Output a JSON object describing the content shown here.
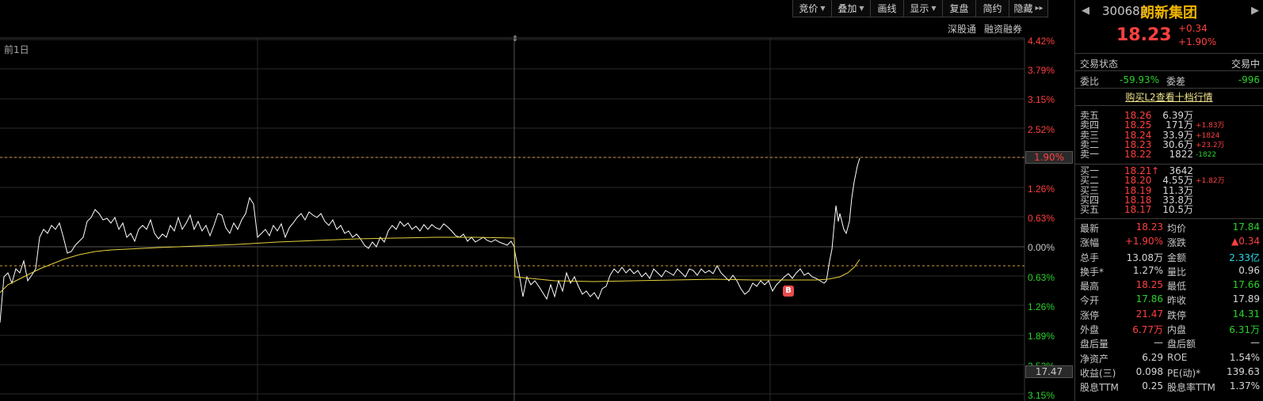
{
  "toolbar": {
    "bid": "竞价",
    "overlay": "叠加",
    "draw": "画线",
    "display": "显示",
    "replay": "复盘",
    "simple": "简约",
    "hide": "隐藏",
    "more": "▸▸"
  },
  "sublinks": {
    "sgt": "深股通",
    "margin": "融资融券"
  },
  "chart": {
    "front_day": "前1日",
    "y_labels": [
      "4.42%",
      "3.79%",
      "3.15%",
      "2.52%",
      "1.90%",
      "1.26%",
      "0.63%",
      "0.00%",
      "0.63%",
      "1.26%",
      "1.89%",
      "2.52%",
      "3.15%"
    ],
    "price_tag": "1.90%",
    "low_tag": "17.47",
    "b_marker": "B",
    "colors": {
      "price_line": "#ffffff",
      "avg_line": "#e8d23c",
      "grid": "#2a2a2a",
      "dash": "#d89a3c"
    }
  },
  "panel": {
    "code": "300682",
    "name": "朗新集团",
    "price": "18.23",
    "change": "+0.34",
    "change_pct": "+1.90%",
    "status_label": "交易状态",
    "status_value": "交易中",
    "wb_label": "委比",
    "wb_value": "-59.93%",
    "wc_label": "委差",
    "wc_value": "-996",
    "l2_link": "购买L2查看十档行情",
    "asks": [
      {
        "label": "卖五",
        "price": "18.26",
        "vol": "6.39万",
        "delta": ""
      },
      {
        "label": "卖四",
        "price": "18.25",
        "vol": "171万",
        "delta": "+1.83万"
      },
      {
        "label": "卖三",
        "price": "18.24",
        "vol": "33.9万",
        "delta": "+1824"
      },
      {
        "label": "卖二",
        "price": "18.23",
        "vol": "30.6万",
        "delta": "+23.2万"
      },
      {
        "label": "卖一",
        "price": "18.22",
        "vol": "1822",
        "delta": "-1822"
      }
    ],
    "bids": [
      {
        "label": "买一",
        "price": "18.21",
        "vol": "3642",
        "delta": ""
      },
      {
        "label": "买二",
        "price": "18.20",
        "vol": "4.55万",
        "delta": "+1.82万"
      },
      {
        "label": "买三",
        "price": "18.19",
        "vol": "11.3万",
        "delta": ""
      },
      {
        "label": "买四",
        "price": "18.18",
        "vol": "33.8万",
        "delta": ""
      },
      {
        "label": "买五",
        "price": "18.17",
        "vol": "10.5万",
        "delta": ""
      }
    ],
    "stats": [
      {
        "l1": "最新",
        "v1": "18.23",
        "c1": "red",
        "l2": "均价",
        "v2": "17.84",
        "c2": "green"
      },
      {
        "l1": "涨幅",
        "v1": "+1.90%",
        "c1": "red",
        "l2": "涨跌",
        "v2": "▲0.34",
        "c2": "red"
      },
      {
        "l1": "总手",
        "v1": "13.08万",
        "c1": "white",
        "l2": "金额",
        "v2": "2.33亿",
        "c2": "cyan"
      },
      {
        "l1": "换手*",
        "v1": "1.27%",
        "c1": "white",
        "l2": "量比",
        "v2": "0.96",
        "c2": "white"
      },
      {
        "l1": "最高",
        "v1": "18.25",
        "c1": "red",
        "l2": "最低",
        "v2": "17.66",
        "c2": "green"
      },
      {
        "l1": "今开",
        "v1": "17.86",
        "c1": "green",
        "l2": "昨收",
        "v2": "17.89",
        "c2": "white"
      },
      {
        "l1": "涨停",
        "v1": "21.47",
        "c1": "red",
        "l2": "跌停",
        "v2": "14.31",
        "c2": "green"
      },
      {
        "l1": "外盘",
        "v1": "6.77万",
        "c1": "red",
        "l2": "内盘",
        "v2": "6.31万",
        "c2": "green"
      },
      {
        "l1": "盘后量",
        "v1": "—",
        "c1": "white",
        "l2": "盘后额",
        "v2": "—",
        "c2": "white"
      },
      {
        "l1": "净资产",
        "v1": "6.29",
        "c1": "white",
        "l2": "ROE",
        "v2": "1.54%",
        "c2": "white"
      },
      {
        "l1": "收益(三)",
        "v1": "0.098",
        "c1": "white",
        "l2": "PE(动)*",
        "v2": "139.63",
        "c2": "white"
      },
      {
        "l1": "股息TTM",
        "v1": "0.25",
        "c1": "white",
        "l2": "股息率TTM",
        "v2": "1.37%",
        "c2": "white"
      }
    ]
  }
}
